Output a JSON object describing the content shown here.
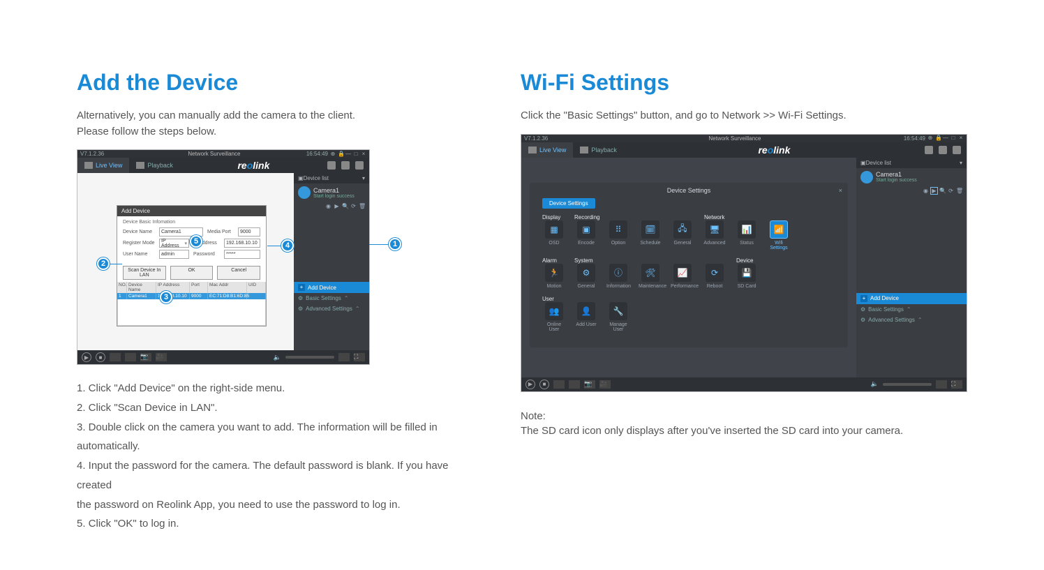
{
  "left": {
    "heading": "Add the Device",
    "intro1": "Alternatively, you can manually add the camera to the client.",
    "intro2": "Please follow the steps below.",
    "instructions": [
      "1. Click \"Add Device\" on the right-side menu.",
      "2. Click \"Scan Device in LAN\".",
      "3. Double click on the camera you want to add. The information will be filled in automatically.",
      "4. Input the password for the camera. The default password is blank. If you have created",
      "the password on Reolink App, you need to use the password to log in.",
      "5. Click \"OK\" to log in."
    ]
  },
  "right": {
    "heading": "Wi-Fi Settings",
    "intro": "Click the \"Basic Settings\" button, and go to Network >> Wi-Fi Settings.",
    "noteLabel": "Note:",
    "noteText": "The SD card icon only displays after you've inserted the SD card into your camera."
  },
  "app": {
    "version": "V7.1.2.36",
    "windowTitle": "Network Surveillance",
    "time": "16:54:49",
    "tabs": {
      "live": "Live View",
      "playback": "Playback"
    },
    "brand_pre": "re",
    "brand_o": "o",
    "brand_post": "link",
    "sidebar": {
      "header": "Device list",
      "deviceName": "Camera1",
      "deviceStatus": "Start login success",
      "addDevice": "Add Device",
      "basic": "Basic Settings",
      "advanced": "Advanced Settings"
    }
  },
  "addDialog": {
    "title": "Add Device",
    "section": "Device Basic Infomation",
    "labels": {
      "deviceName": "Device Name",
      "mediaPort": "Media Port",
      "registerMode": "Register Mode",
      "ipAddress": "IP Address",
      "userName": "User Name",
      "password": "Password"
    },
    "values": {
      "deviceName": "Camera1",
      "mediaPort": "9000",
      "registerMode": "IP Address",
      "ipAddress": "192.168.10.10",
      "userName": "admin",
      "password": "*****"
    },
    "buttons": {
      "scan": "Scan Device In LAN",
      "ok": "OK",
      "cancel": "Cancel"
    },
    "table": {
      "headers": {
        "no": "NO.",
        "name": "Device Name",
        "ip": "IP Address",
        "port": "Port",
        "mac": "Mac Addr",
        "uid": "UID"
      },
      "row": {
        "no": "1",
        "name": "Camera1",
        "ip": "192.168.10.10",
        "port": "9000",
        "mac": "EC:71:D8:B1:6D:85",
        "uid": ""
      }
    }
  },
  "annotations": {
    "a1": "1",
    "a2": "2",
    "a3": "3",
    "a4": "4",
    "a5": "5"
  },
  "settings": {
    "title": "Device Settings",
    "crumb": "Device Settings",
    "groups": {
      "display": "Display",
      "recording": "Recording",
      "network": "Network",
      "alarm": "Alarm",
      "system": "System",
      "device": "Device",
      "user": "User"
    },
    "tiles": {
      "osd": "OSD",
      "encode": "Encode",
      "option": "Option",
      "schedule": "Schedule",
      "general": "General",
      "advanced": "Advanced",
      "status": "Status",
      "wifi": "Wifi Settings",
      "motion": "Motion",
      "sysGeneral": "General",
      "info": "Information",
      "maint": "Maintenance",
      "perf": "Performance",
      "reboot": "Reboot",
      "sd": "SD Card",
      "online": "Online User",
      "addUser": "Add User",
      "manage": "Manage User"
    }
  }
}
